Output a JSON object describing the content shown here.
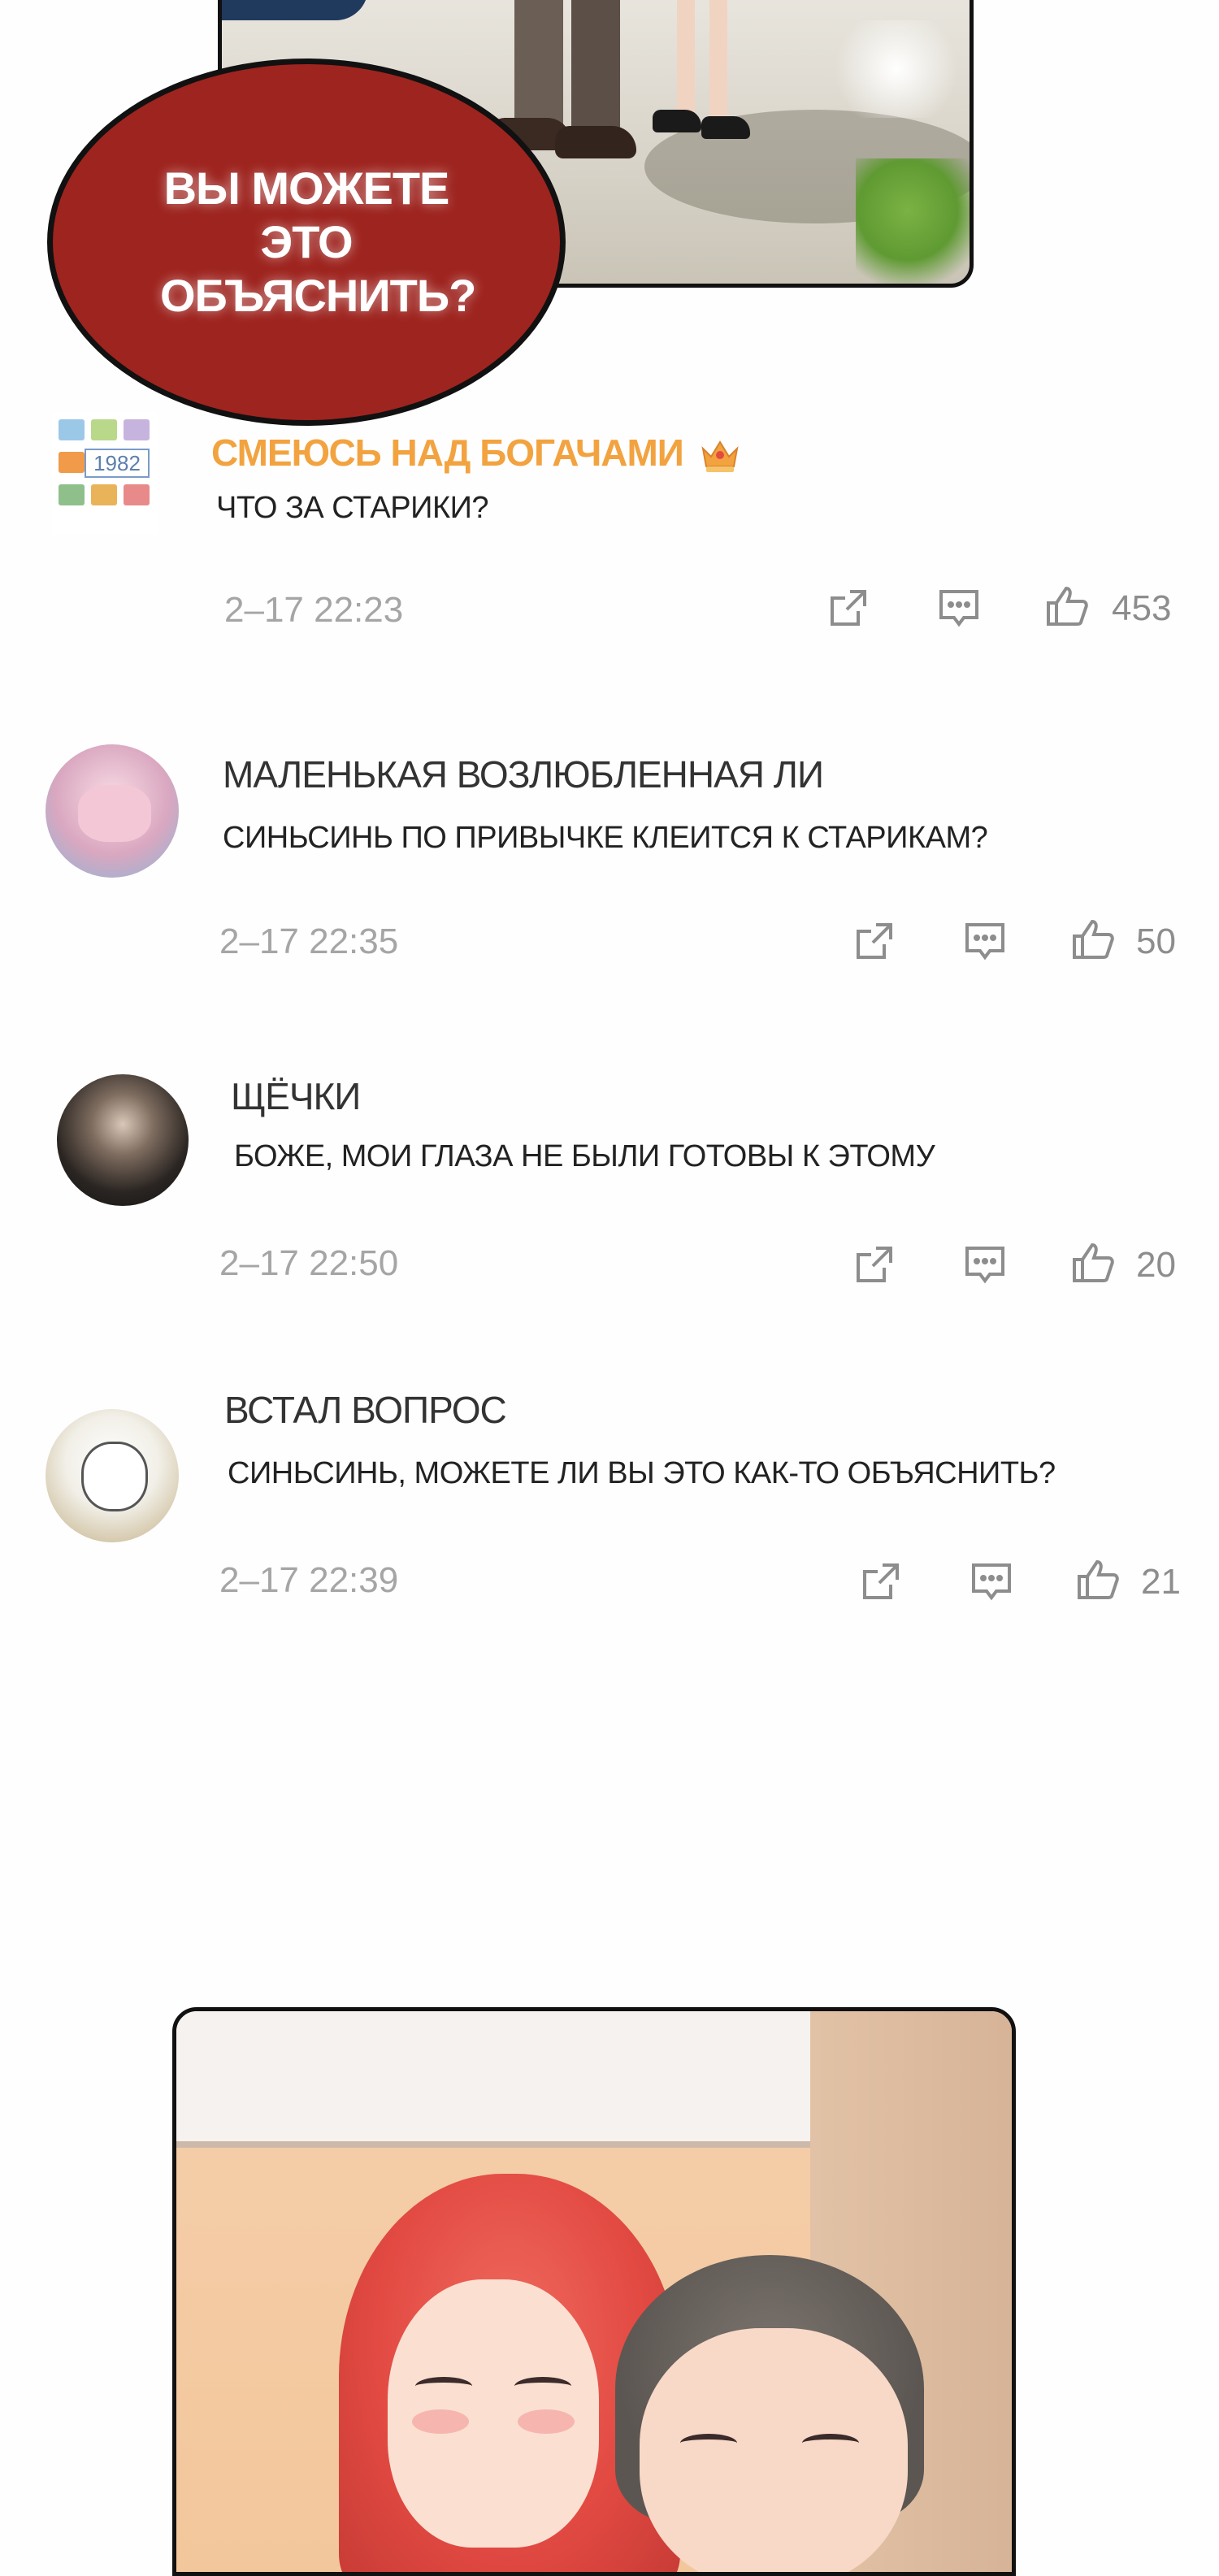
{
  "comic_top": {
    "bubble_text_line1": "ВЫ МОЖЕТЕ ЭТО",
    "bubble_text_line2": "ОБЪЯСНИТЬ?",
    "bubble_color": "#9e241f"
  },
  "comments": [
    {
      "username": "СМЕЮСЬ НАД БОГАЧАМИ",
      "vip": true,
      "badge_icon": "crown-icon",
      "avatar_text": "1982",
      "text": "ЧТО ЗА СТАРИКИ?",
      "time": "2–17 22:23",
      "likes": "453"
    },
    {
      "username": "МАЛЕНЬКАЯ ВОЗЛЮБЛЕННАЯ ЛИ",
      "text": "СИНЬСИНЬ ПО ПРИВЫЧКЕ КЛЕИТСЯ К СТАРИКАМ?",
      "time": "2–17 22:35",
      "likes": "50"
    },
    {
      "username": "ЩЁЧКИ",
      "text": "БОЖЕ, МОИ ГЛАЗА НЕ БЫЛИ ГОТОВЫ К ЭТОМУ",
      "time": "2–17 22:50",
      "likes": "20"
    },
    {
      "username": "ВСТАЛ ВОПРОС",
      "text": "СИНЬСИНЬ, МОЖЕТЕ ЛИ ВЫ ЭТО КАК-ТО ОБЪЯСНИТЬ?",
      "time": "2–17 22:39",
      "likes": "21"
    }
  ],
  "icons": {
    "share": "share-icon",
    "reply": "comment-icon",
    "like": "thumbs-up-icon"
  },
  "colors": {
    "vip_username": "#f2a340",
    "meta_text": "#a5a5a5"
  }
}
